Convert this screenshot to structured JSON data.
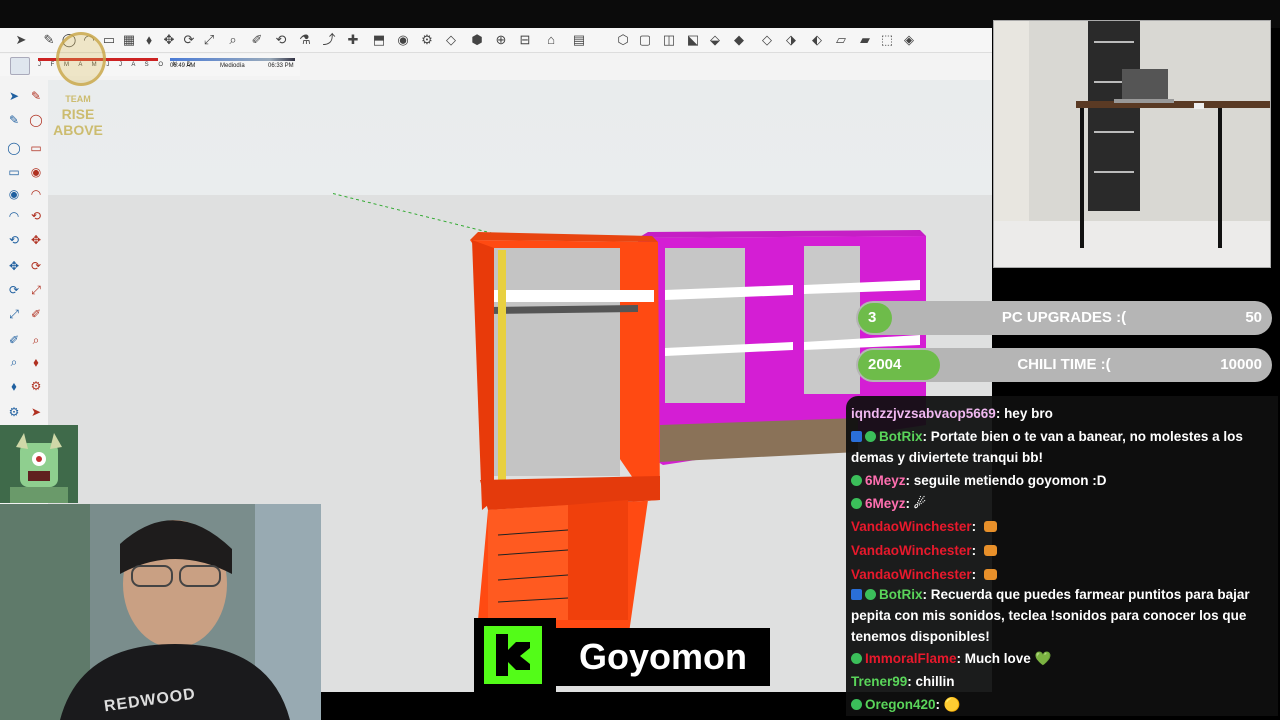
{
  "shadow": {
    "months": "J F M A M J J A S O N D",
    "time_start": "06:49 AM",
    "time_mid": "Mediodía",
    "time_end": "06:33 PM"
  },
  "team_logo": {
    "top": "TEAM",
    "bottom": "RISE ABOVE"
  },
  "goals": [
    {
      "level": "3",
      "label": "PC UPGRADES :(",
      "target": "50",
      "progress": 0.06
    },
    {
      "level": "2004",
      "label": "CHILI TIME :(",
      "target": "10000",
      "progress": 0.2
    }
  ],
  "chat": [
    {
      "user": "iqndzzjvzsabvaop5669",
      "sep": ": ",
      "text": "hey bro",
      "color": "#f0b8f0",
      "badges": []
    },
    {
      "user": "BotRix",
      "sep": ": ",
      "text": "Portate bien o te van a banear, no molestes a los demas y diviertete tranqui bb!",
      "color": "#5ad55a",
      "badges": [
        "sq",
        "gear"
      ]
    },
    {
      "user": "6Meyz",
      "sep": ": ",
      "text": "seguile metiendo goyomon :D",
      "color": "#ff6fb0",
      "badges": [
        "gear"
      ]
    },
    {
      "user": "6Meyz",
      "sep": ": ",
      "text": "☄",
      "color": "#ff6fb0",
      "badges": [
        "gear"
      ]
    },
    {
      "user": "VandaoWinchester",
      "sep": ": ",
      "text": "",
      "color": "#e8192c",
      "badges": [],
      "emote": true
    },
    {
      "user": "VandaoWinchester",
      "sep": ": ",
      "text": "",
      "color": "#e8192c",
      "badges": [],
      "emote": true
    },
    {
      "user": "VandaoWinchester",
      "sep": ": ",
      "text": "",
      "color": "#e8192c",
      "badges": [],
      "emote": true
    },
    {
      "user": "BotRix",
      "sep": ": ",
      "text": "Recuerda que puedes farmear puntitos para bajar pepita con mis sonidos, teclea !sonidos para conocer los que tenemos disponibles!",
      "color": "#5ad55a",
      "badges": [
        "sq",
        "gear"
      ]
    },
    {
      "user": "ImmoralFlame",
      "sep": ": ",
      "text": "Much love 💚",
      "color": "#e8192c",
      "badges": [
        "gear"
      ]
    },
    {
      "user": "Trener99",
      "sep": ": ",
      "text": "chillin",
      "color": "#5ad55a",
      "badges": []
    },
    {
      "user": "Oregon420",
      "sep": ": ",
      "text": "🟡",
      "color": "#5ad55a",
      "badges": [
        "gear"
      ]
    }
  ],
  "streamer": {
    "name": "Goyomon"
  },
  "webcam": {
    "shirt_text": "REDWOOD"
  }
}
